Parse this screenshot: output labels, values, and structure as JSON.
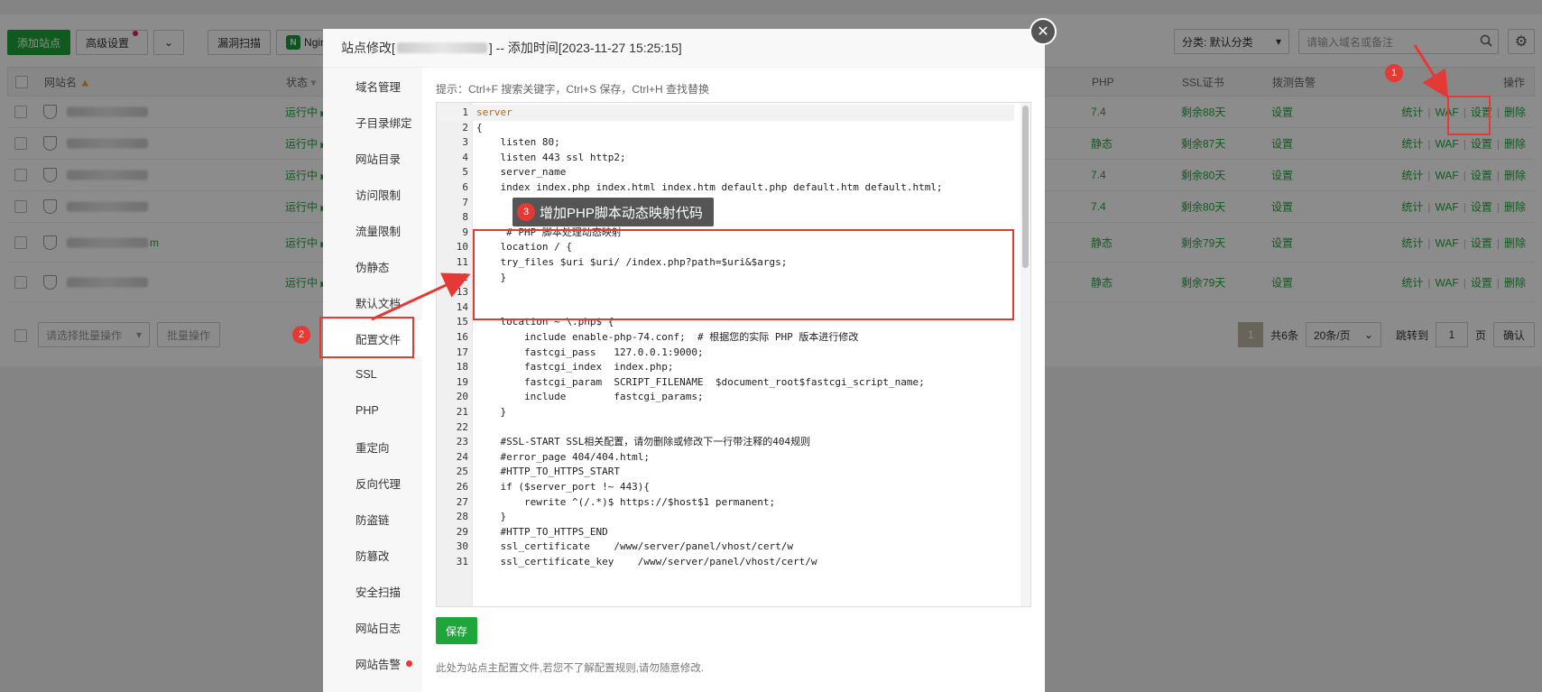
{
  "toolbar": {
    "add_site": "添加站点",
    "advanced": "高级设置",
    "scan": "漏洞扫描",
    "nginx": "Ngin"
  },
  "filters": {
    "category": "分类: 默认分类",
    "search_placeholder": "请输入域名或备注"
  },
  "table": {
    "headers": {
      "name": "网站名",
      "status": "状态",
      "php": "PHP",
      "ssl": "SSL证书",
      "alert": "拨测告警",
      "ops": "操作"
    },
    "rows": [
      {
        "status": "运行中",
        "php": "7.4",
        "ssl": "剩余88天",
        "alert": "设置"
      },
      {
        "status": "运行中",
        "php": "静态",
        "ssl": "剩余87天",
        "alert": "设置"
      },
      {
        "status": "运行中",
        "php": "7.4",
        "ssl": "剩余80天",
        "alert": "设置"
      },
      {
        "status": "运行中",
        "php": "7.4",
        "ssl": "剩余80天",
        "alert": "设置"
      },
      {
        "status": "运行中",
        "php": "静态",
        "ssl": "剩余79天",
        "alert": "设置",
        "name_suffix": "m"
      },
      {
        "status": "运行中",
        "php": "静态",
        "ssl": "剩余79天",
        "alert": "设置"
      }
    ],
    "ops": {
      "stats": "统计",
      "waf": "WAF",
      "settings": "设置",
      "delete": "删除"
    }
  },
  "batch": {
    "select_placeholder": "请选择批量操作",
    "button": "批量操作"
  },
  "pager": {
    "current": "1",
    "total": "共6条",
    "per_page": "20条/页",
    "goto_label": "跳转到",
    "goto_value": "1",
    "page_unit": "页",
    "confirm": "确认"
  },
  "modal": {
    "title_prefix": "站点修改[",
    "title_suffix": "] -- 添加时间[2023-11-27 15:25:15]",
    "nav": [
      "域名管理",
      "子目录绑定",
      "网站目录",
      "访问限制",
      "流量限制",
      "伪静态",
      "默认文档",
      "配置文件",
      "SSL",
      "PHP",
      "重定向",
      "反向代理",
      "防盗链",
      "防篡改",
      "安全扫描",
      "网站日志",
      "网站告警"
    ],
    "hint": "提示：Ctrl+F 搜索关键字，Ctrl+S 保存，Ctrl+H 查找替换",
    "save": "保存",
    "footnote": "此处为站点主配置文件,若您不了解配置规则,请勿随意修改."
  },
  "code": [
    {
      "n": "1",
      "t": "server"
    },
    {
      "n": "2",
      "t": "{"
    },
    {
      "n": "3",
      "t": "    listen 80;"
    },
    {
      "n": "4",
      "t": "    listen 443 ssl http2;"
    },
    {
      "n": "5",
      "t": "    server_name"
    },
    {
      "n": "6",
      "t": "    index index.php index.html index.htm default.php default.htm default.html;"
    },
    {
      "n": "7",
      "t": ""
    },
    {
      "n": "8",
      "t": ""
    },
    {
      "n": "9",
      "t": "     # PHP 脚本处理动态映射"
    },
    {
      "n": "10",
      "t": "    location / {"
    },
    {
      "n": "11",
      "t": "    try_files $uri $uri/ /index.php?path=$uri&$args;"
    },
    {
      "n": "12",
      "t": "    }"
    },
    {
      "n": "13",
      "t": ""
    },
    {
      "n": "14",
      "t": ""
    },
    {
      "n": "15",
      "t": "    location ~ \\.php$ {"
    },
    {
      "n": "16",
      "t": "        include enable-php-74.conf;  # 根据您的实际 PHP 版本进行修改"
    },
    {
      "n": "17",
      "t": "        fastcgi_pass   127.0.0.1:9000;"
    },
    {
      "n": "18",
      "t": "        fastcgi_index  index.php;"
    },
    {
      "n": "19",
      "t": "        fastcgi_param  SCRIPT_FILENAME  $document_root$fastcgi_script_name;"
    },
    {
      "n": "20",
      "t": "        include        fastcgi_params;"
    },
    {
      "n": "21",
      "t": "    }"
    },
    {
      "n": "22",
      "t": ""
    },
    {
      "n": "23",
      "t": "    #SSL-START SSL相关配置，请勿删除或修改下一行带注释的404规则"
    },
    {
      "n": "24",
      "t": "    #error_page 404/404.html;"
    },
    {
      "n": "25",
      "t": "    #HTTP_TO_HTTPS_START"
    },
    {
      "n": "26",
      "t": "    if ($server_port !~ 443){"
    },
    {
      "n": "27",
      "t": "        rewrite ^(/.*)$ https://$host$1 permanent;"
    },
    {
      "n": "28",
      "t": "    }"
    },
    {
      "n": "29",
      "t": "    #HTTP_TO_HTTPS_END"
    },
    {
      "n": "30",
      "t": "    ssl_certificate    /www/server/panel/vhost/cert/w"
    },
    {
      "n": "31",
      "t": "    ssl_certificate_key    /www/server/panel/vhost/cert/w"
    }
  ],
  "annotations": {
    "step1": "1",
    "step2": "2",
    "step3": "3",
    "tooltip": "增加PHP脚本动态映射代码",
    "color": "#e53935"
  }
}
